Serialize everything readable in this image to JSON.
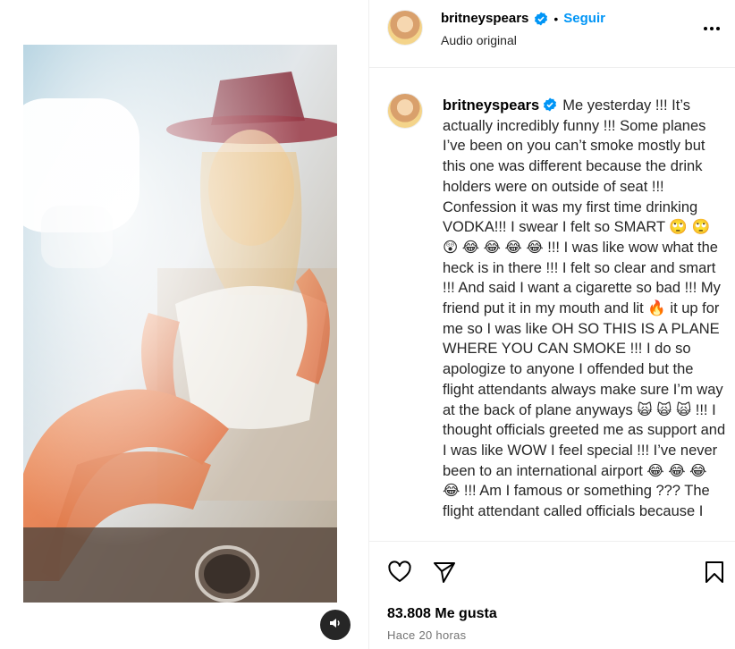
{
  "post": {
    "username": "britneyspears",
    "follow_label": "Seguir",
    "dot": "•",
    "audio_label": "Audio original",
    "caption": "Me yesterday !!! It’s actually incredibly funny !!! Some planes I’ve been on you can’t smoke mostly but this one was different because the drink holders were on outside of seat !!! Confession it was my first time drinking VODKA!!! I swear I felt so SMART 🙄 🙄 😲 😂 😂 😂 😂 !!! I was like wow what the heck is in there !!! I felt so clear and smart !!! And said I want a cigarette so bad !!! My friend put it in my mouth and lit 🔥 it up for me so I was like OH SO THIS IS A PLANE WHERE YOU CAN SMOKE !!! I do so apologize to anyone I offended but the flight attendants always make sure I’m way at the back of plane anyways 🙀 🙀 🙀 !!! I thought officials greeted me as support and I was like WOW I feel special !!! I’ve never been to an international airport 😂 😂 😂 😂 !!! Am I famous or something ??? The flight attendant called officials because I",
    "likes": "83.808 Me gusta",
    "time": "Hace 20 horas"
  },
  "icons": {
    "more": "more-options-icon",
    "like": "heart-icon",
    "share": "share-icon",
    "save": "bookmark-icon",
    "audio": "speaker-icon",
    "verified": "verified-badge-icon"
  },
  "colors": {
    "accent": "#0095f6",
    "verified": "#0095f6",
    "muted": "#737373",
    "divider": "#efefef"
  }
}
